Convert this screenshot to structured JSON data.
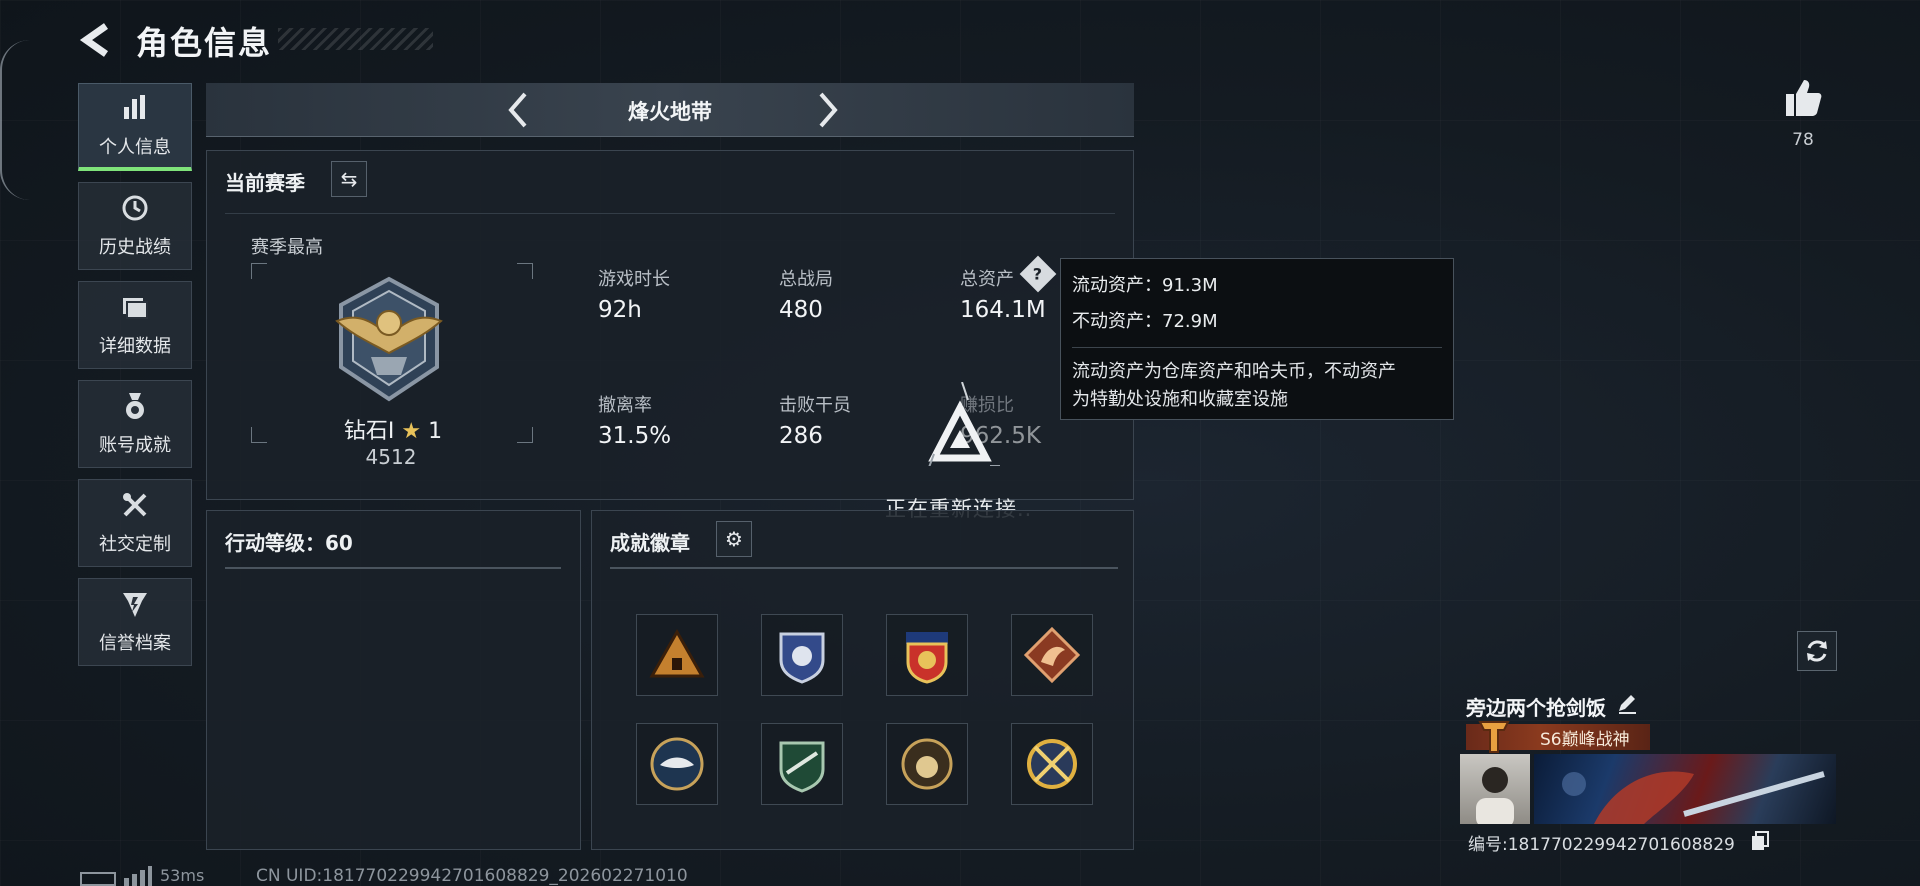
{
  "header": {
    "title": "角色信息"
  },
  "sidebar": {
    "items": [
      {
        "label": "个人信息",
        "icon": "bar-chart-icon",
        "active": true
      },
      {
        "label": "历史战绩",
        "icon": "history-icon"
      },
      {
        "label": "详细数据",
        "icon": "folder-icon"
      },
      {
        "label": "账号成就",
        "icon": "medal-icon"
      },
      {
        "label": "社交定制",
        "icon": "tools-icon"
      },
      {
        "label": "信誉档案",
        "icon": "credit-icon"
      }
    ]
  },
  "mode_bar": {
    "title": "烽火地带"
  },
  "season_panel": {
    "title": "当前赛季",
    "best_label": "赛季最高",
    "rank_name": "钻石Ⅰ",
    "rank_stars": "1",
    "rank_score": "4512",
    "stats": [
      {
        "label": "游戏时长",
        "value": "92h"
      },
      {
        "label": "总战局",
        "value": "480"
      },
      {
        "label": "总资产",
        "value": "164.1M"
      },
      {
        "label": "撤离率",
        "value": "31.5%"
      },
      {
        "label": "击败干员",
        "value": "286"
      },
      {
        "label": "赚损比",
        "value": "962.5K"
      }
    ]
  },
  "tooltip": {
    "liquid": "流动资产：91.3M",
    "fixed": "不动资产：72.9M",
    "desc_line1": "流动资产为仓库资产和哈夫币，不动资产",
    "desc_line2": "为特勤处设施和收藏室设施"
  },
  "reconnect": {
    "text": "正在重新连接.."
  },
  "action_panel": {
    "title": "行动等级：60"
  },
  "badge_panel": {
    "title": "成就徽章",
    "badges": [
      "triangle-badge-icon",
      "shield-badge-icon",
      "eagle-crest-badge-icon",
      "dragon-badge-icon",
      "eagle-badge-icon",
      "rifle-badge-icon",
      "orb-badge-icon",
      "cross-guns-badge-icon"
    ]
  },
  "likes": {
    "count": "78"
  },
  "player": {
    "name": "旁边两个抢剑饭",
    "rank_tag": "S6巅峰战神",
    "serial": "编号:18177022994270160882⁠9"
  },
  "footer": {
    "ping": "53ms",
    "uid": "CN UID:18177022994270160882⁠9_202602271010"
  },
  "colors": {
    "accent_green": "#7fe37a",
    "tooltip_bg": "#0c0f12",
    "rank_tag": "#8a3a1e"
  }
}
